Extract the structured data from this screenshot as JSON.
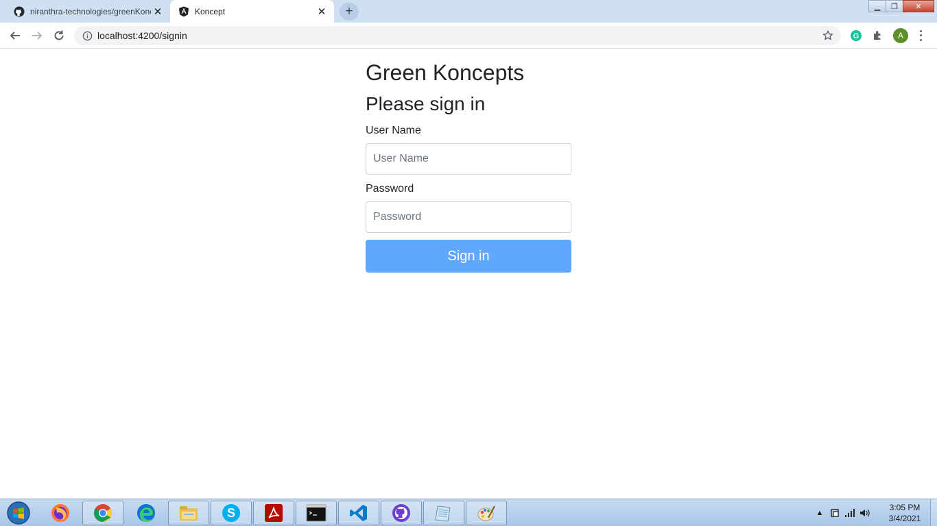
{
  "browser": {
    "tabs": [
      {
        "title": "niranthra-technologies/greenKoncepts",
        "icon": "github-icon",
        "active": false
      },
      {
        "title": "Koncept",
        "icon": "angular-icon",
        "active": true
      }
    ],
    "address": "localhost:4200/signin",
    "profile_initial": "A"
  },
  "page": {
    "app_title": "Green Koncepts",
    "form_title": "Please sign in",
    "username_label": "User Name",
    "username_placeholder": "User Name",
    "password_label": "Password",
    "password_placeholder": "Password",
    "submit_label": "Sign in"
  },
  "taskbar": {
    "apps": [
      "firefox",
      "chrome",
      "edge",
      "file-explorer",
      "skype",
      "acrobat",
      "command-prompt",
      "vs-code",
      "github-desktop",
      "notepad",
      "paint"
    ],
    "time": "3:05 PM",
    "date": "3/4/2021"
  },
  "colors": {
    "primary_button": "#5fa8fb",
    "tabstrip": "#cfe0f3",
    "taskbar": "#b8d1ee"
  }
}
